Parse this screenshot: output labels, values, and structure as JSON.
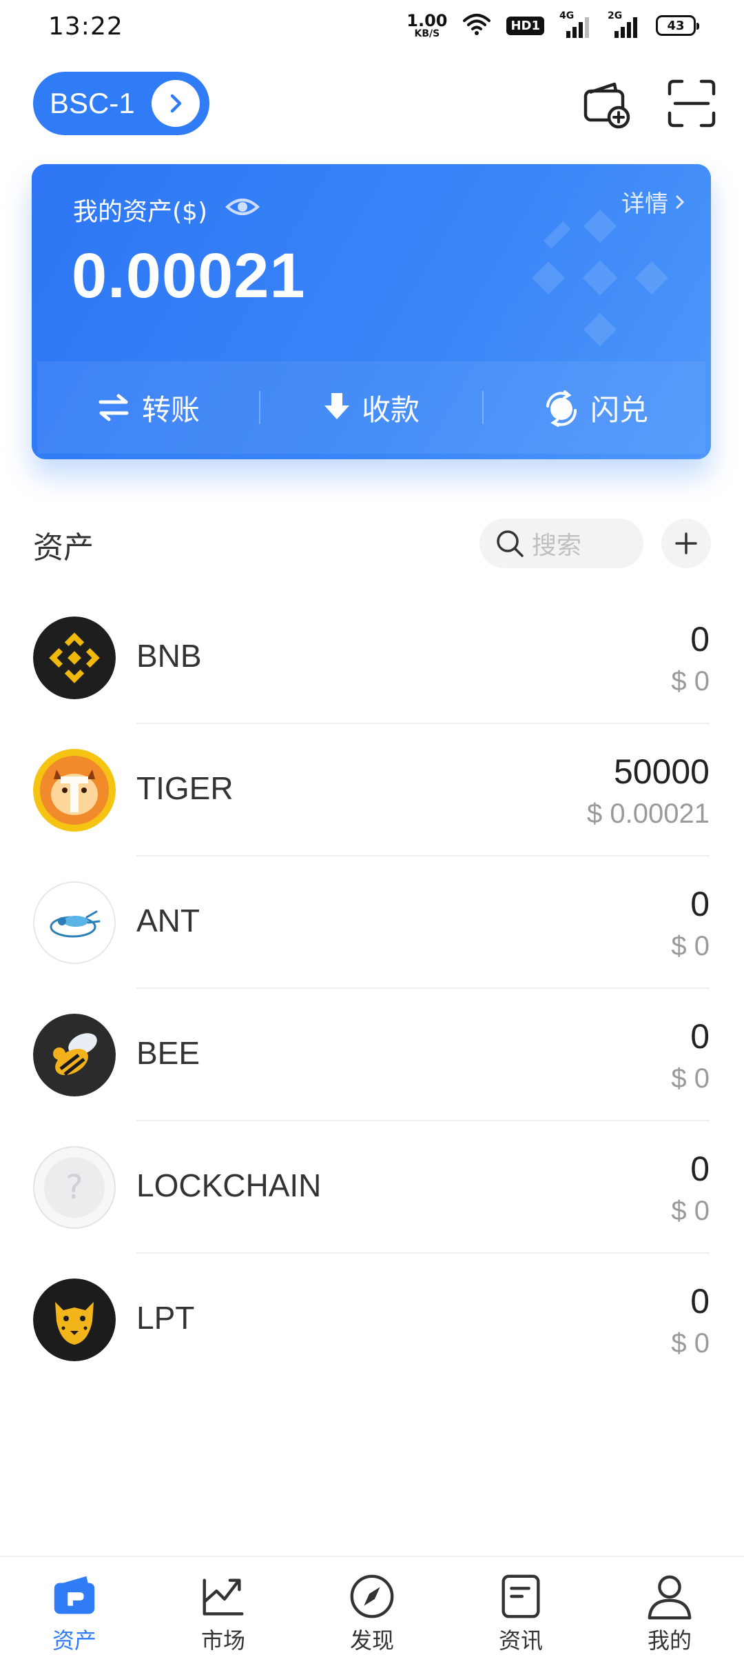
{
  "status_bar": {
    "time": "13:22",
    "net_speed_value": "1.00",
    "net_speed_unit": "KB/S",
    "hd_badge": "HD1",
    "signal_1_gen": "4G",
    "signal_2_gen": "2G",
    "battery": "43"
  },
  "header": {
    "network_label": "BSC-1",
    "icons": [
      "wallet-add-icon",
      "scan-icon"
    ]
  },
  "asset_card": {
    "title": "我的资产($)",
    "detail_label": "详情",
    "amount": "0.00021",
    "actions": [
      {
        "label": "转账",
        "icon": "transfer-icon"
      },
      {
        "label": "收款",
        "icon": "receive-icon"
      },
      {
        "label": "闪兑",
        "icon": "swap-icon"
      }
    ]
  },
  "assets_section": {
    "title": "资产",
    "search_placeholder": "搜索"
  },
  "assets": [
    {
      "name": "BNB",
      "amount": "0",
      "usd": "$ 0",
      "icon": "bnb-coin-icon"
    },
    {
      "name": "TIGER",
      "amount": "50000",
      "usd": "$ 0.00021",
      "icon": "tiger-coin-icon"
    },
    {
      "name": "ANT",
      "amount": "0",
      "usd": "$ 0",
      "icon": "ant-coin-icon"
    },
    {
      "name": "BEE",
      "amount": "0",
      "usd": "$ 0",
      "icon": "bee-coin-icon"
    },
    {
      "name": "LOCKCHAIN",
      "amount": "0",
      "usd": "$ 0",
      "icon": "unknown-coin-icon"
    },
    {
      "name": "LPT",
      "amount": "0",
      "usd": "$ 0",
      "icon": "cheetah-coin-icon"
    }
  ],
  "bottom_nav": [
    {
      "label": "资产",
      "active": true
    },
    {
      "label": "市场",
      "active": false
    },
    {
      "label": "发现",
      "active": false
    },
    {
      "label": "资讯",
      "active": false
    },
    {
      "label": "我的",
      "active": false
    }
  ],
  "colors": {
    "primary": "#2f7cf6",
    "text": "#333333",
    "muted": "#9a9a9a",
    "bnb_gold": "#f0b90b"
  }
}
